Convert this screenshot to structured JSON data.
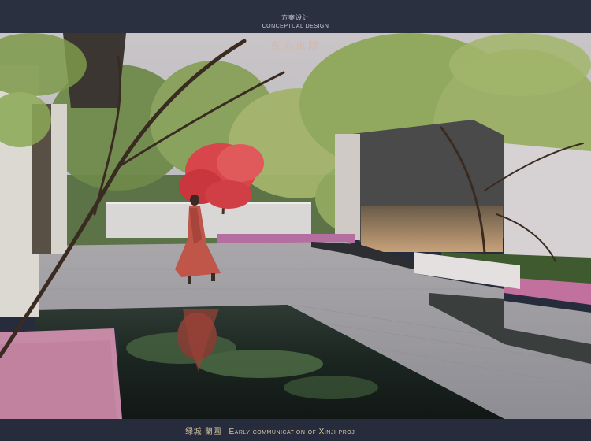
{
  "header": {
    "title_cn": "方案设计",
    "title_en": "CONCEPTUAL DESIGN"
  },
  "photo": {
    "overlay_title": "东方水院",
    "scene": "render"
  },
  "footer": {
    "brand_cn": "绿城·蘭園",
    "separator": "|",
    "text_en": "Early communication of Xinji proj"
  },
  "colors": {
    "header_bg": "#2a3040",
    "accent_gold": "#d8c6a6",
    "maple_red": "#d8454a",
    "dress": "#c0564a"
  }
}
